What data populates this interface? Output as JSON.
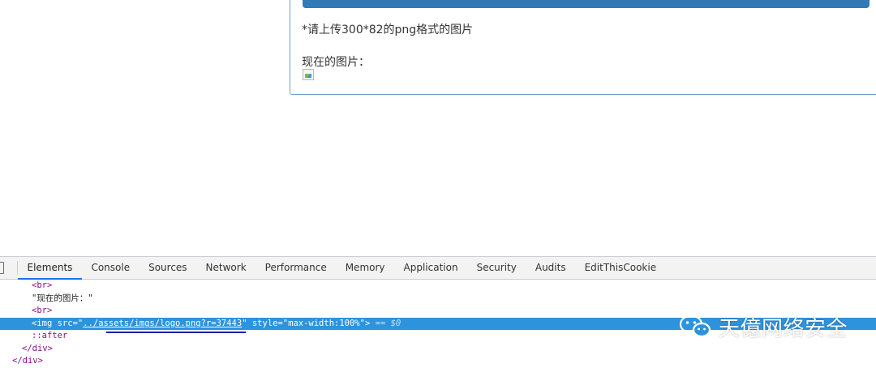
{
  "page": {
    "upload_hint": "*请上传300*82的png格式的图片",
    "current_image_label": "现在的图片："
  },
  "devtools": {
    "tabs": [
      {
        "label": "Elements",
        "active": true
      },
      {
        "label": "Console"
      },
      {
        "label": "Sources"
      },
      {
        "label": "Network"
      },
      {
        "label": "Performance"
      },
      {
        "label": "Memory"
      },
      {
        "label": "Application"
      },
      {
        "label": "Security"
      },
      {
        "label": "Audits"
      },
      {
        "label": "EditThisCookie"
      }
    ],
    "dom": {
      "br1": "<br>",
      "text_node": "\"现在的图片：\"",
      "br2": "<br>",
      "img_open": "<img ",
      "img_src_name": "src",
      "img_src_eq": "=\"",
      "img_src_value": "../assets/imgs/logo.png?r=37443",
      "img_src_close": "\"",
      "img_style_name": " style",
      "img_style_eq": "=\"",
      "img_style_value": "max-width:100%",
      "img_close": "\">",
      "selected_ref": " == $0",
      "after": "::after",
      "close_div1": "</div>",
      "close_div2": "</div>"
    },
    "selected_line_color": "#2e93dd",
    "annotation_color": "#1c1fa8"
  },
  "watermark": {
    "icon": "wechat-icon",
    "text": "天億网络安全"
  }
}
